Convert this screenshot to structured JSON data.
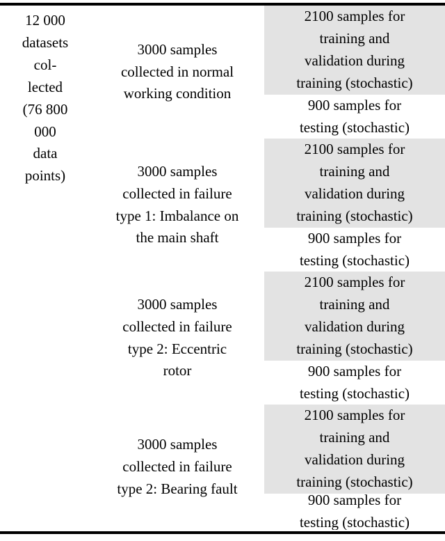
{
  "table": {
    "border_color": "#000000",
    "shaded_cell_color": "#e3e3e3",
    "plain_cell_color": "#ffffff",
    "text_color": "#000000",
    "summary_cell": "12 000\ndatasets\ncol-\nlected\n(76 800\n000\ndata\npoints)",
    "groups": [
      {
        "condition": "3000 samples\ncollected in normal\nworking condition",
        "train_split": "2100 samples for\ntraining and\nvalidation during\ntraining (stochastic)",
        "test_split": "900 samples for\ntesting (stochastic)"
      },
      {
        "condition": "3000 samples\ncollected in failure\ntype 1: Imbalance on\nthe main shaft",
        "train_split": "2100 samples for\ntraining and\nvalidation during\ntraining (stochastic)",
        "test_split": "900 samples for\ntesting (stochastic)"
      },
      {
        "condition": "3000 samples\ncollected in failure\ntype 2: Eccentric\nrotor",
        "train_split": "2100 samples for\ntraining and\nvalidation during\ntraining (stochastic)",
        "test_split": "900 samples for\ntesting (stochastic)"
      },
      {
        "condition": "3000 samples\ncollected in failure\ntype 2: Bearing fault",
        "train_split": "2100 samples for\ntraining and\nvalidation during\ntraining (stochastic)",
        "test_split": "900 samples for\ntesting (stochastic)"
      }
    ]
  }
}
